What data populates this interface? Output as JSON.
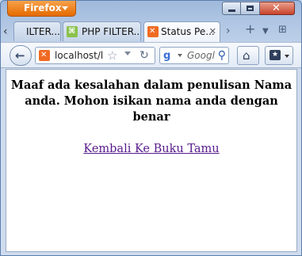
{
  "browser": {
    "menu_label": "Firefox",
    "tabs": [
      {
        "label": "ILTER..."
      },
      {
        "label": "PHP FILTER..."
      },
      {
        "label": "Status Pe..."
      }
    ],
    "new_tab": "+",
    "url": "localhost/l",
    "search_engine_icon": "google-icon",
    "search_placeholder": "Googl"
  },
  "page": {
    "message": "Maaf ada kesalahan dalam penulisan Nama anda. Mohon isikan nama anda dengan benar",
    "link_text": "Kembali Ke Buku Tamu",
    "link_color": "#551a8b"
  },
  "colors": {
    "firefox_button": "#e56a00",
    "close_button": "#c8432a",
    "tab_favicon": "#f06a22"
  }
}
